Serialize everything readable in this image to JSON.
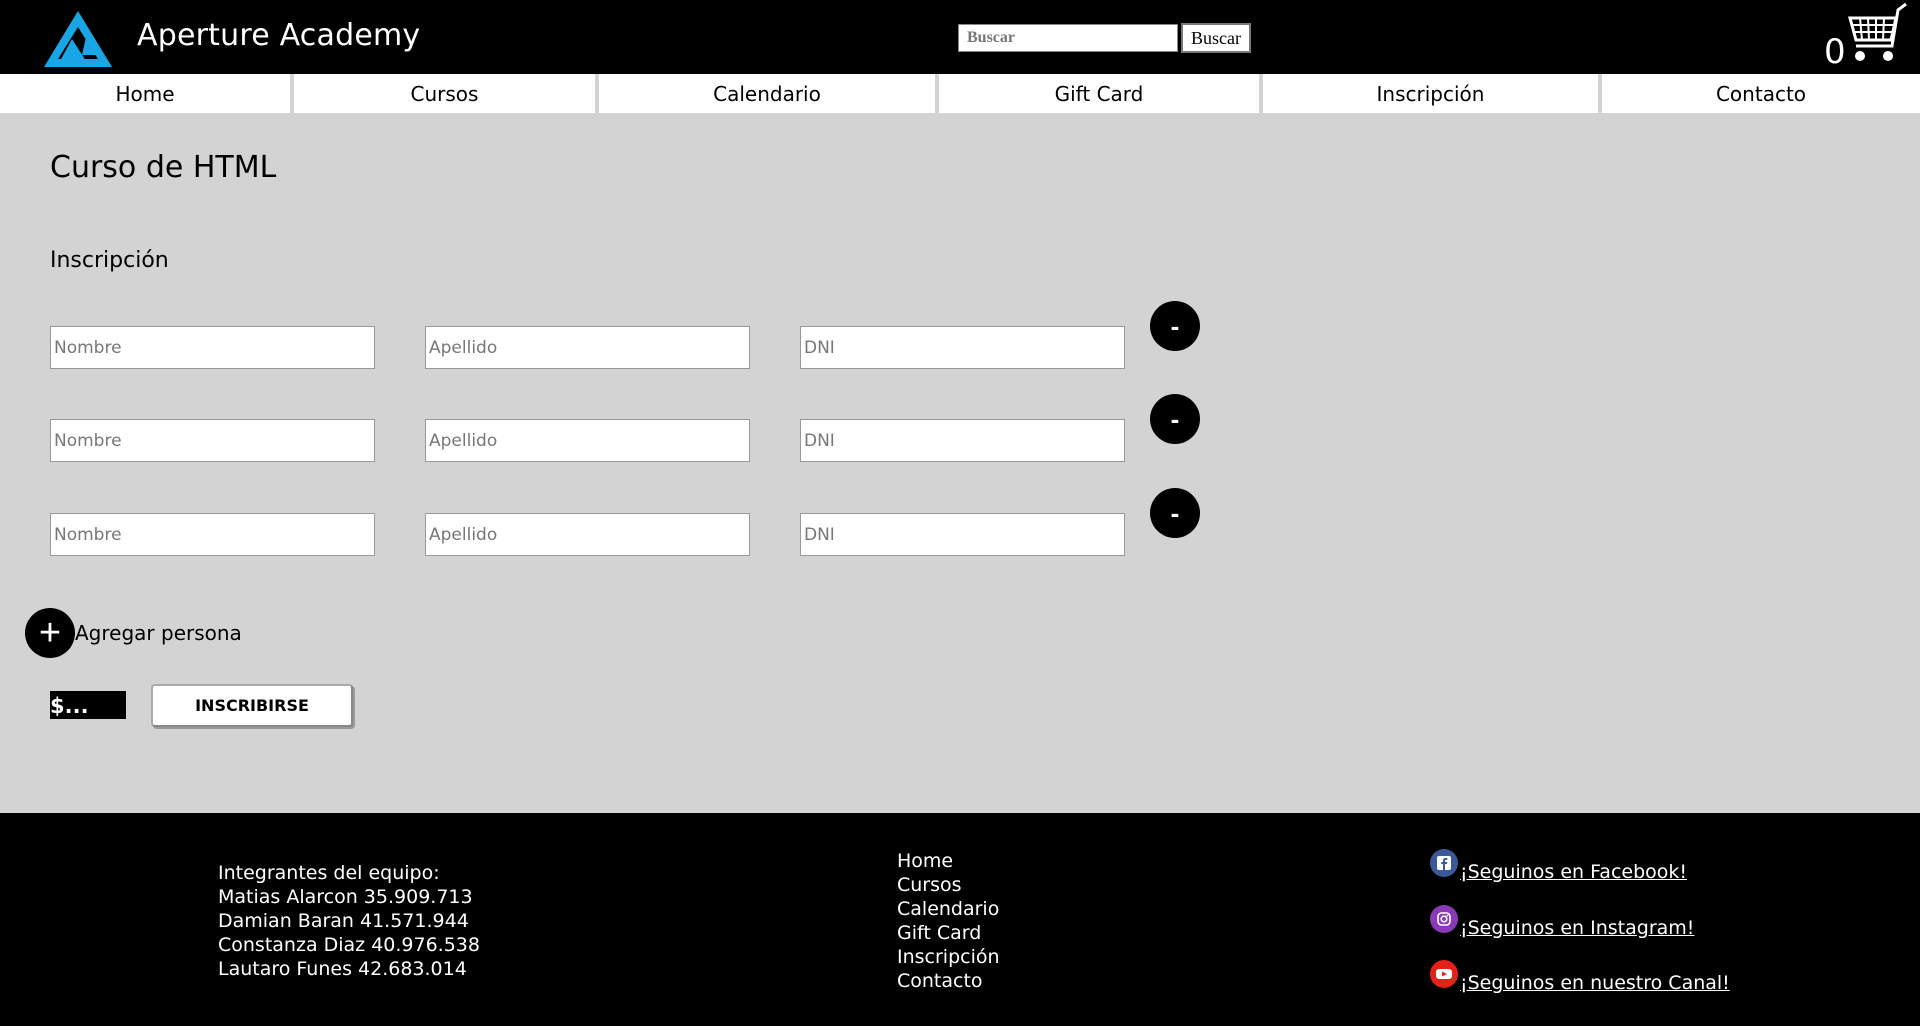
{
  "header": {
    "brand": "Aperture Academy",
    "search_placeholder": "Buscar",
    "search_button": "Buscar",
    "cart_count": "0",
    "logo_color": "#19a6e6"
  },
  "nav": {
    "items": [
      "Home",
      "Cursos",
      "Calendario",
      "Gift Card",
      "Inscripción",
      "Contacto"
    ]
  },
  "main": {
    "course_title": "Curso de HTML",
    "section_title": "Inscripción",
    "rows": [
      {
        "nombre_placeholder": "Nombre",
        "apellido_placeholder": "Apellido",
        "dni_placeholder": "DNI",
        "remove_label": "-"
      },
      {
        "nombre_placeholder": "Nombre",
        "apellido_placeholder": "Apellido",
        "dni_placeholder": "DNI",
        "remove_label": "-"
      },
      {
        "nombre_placeholder": "Nombre",
        "apellido_placeholder": "Apellido",
        "dni_placeholder": "DNI",
        "remove_label": "-"
      }
    ],
    "add_icon": "+",
    "add_label": "Agregar persona",
    "price": "$...",
    "enroll_button": "INSCRIBIRSE"
  },
  "footer": {
    "team_heading": "Integrantes del equipo:",
    "team": [
      "Matias Alarcon 35.909.713",
      "Damian Baran 41.571.944",
      "Constanza Diaz 40.976.538",
      "Lautaro Funes 42.683.014"
    ],
    "links": [
      "Home",
      "Cursos",
      "Calendario",
      "Gift Card",
      "Inscripción",
      "Contacto"
    ],
    "social": {
      "facebook": {
        "label": "¡Seguinos en Facebook!",
        "icon": "facebook-icon",
        "color": "#3b5998"
      },
      "instagram": {
        "label": "¡Seguinos en Instagram!",
        "icon": "instagram-icon",
        "color": "#8a3ab9"
      },
      "youtube": {
        "label": "¡Seguinos en nuestro Canal!",
        "icon": "youtube-icon",
        "color": "#e62117"
      }
    }
  }
}
